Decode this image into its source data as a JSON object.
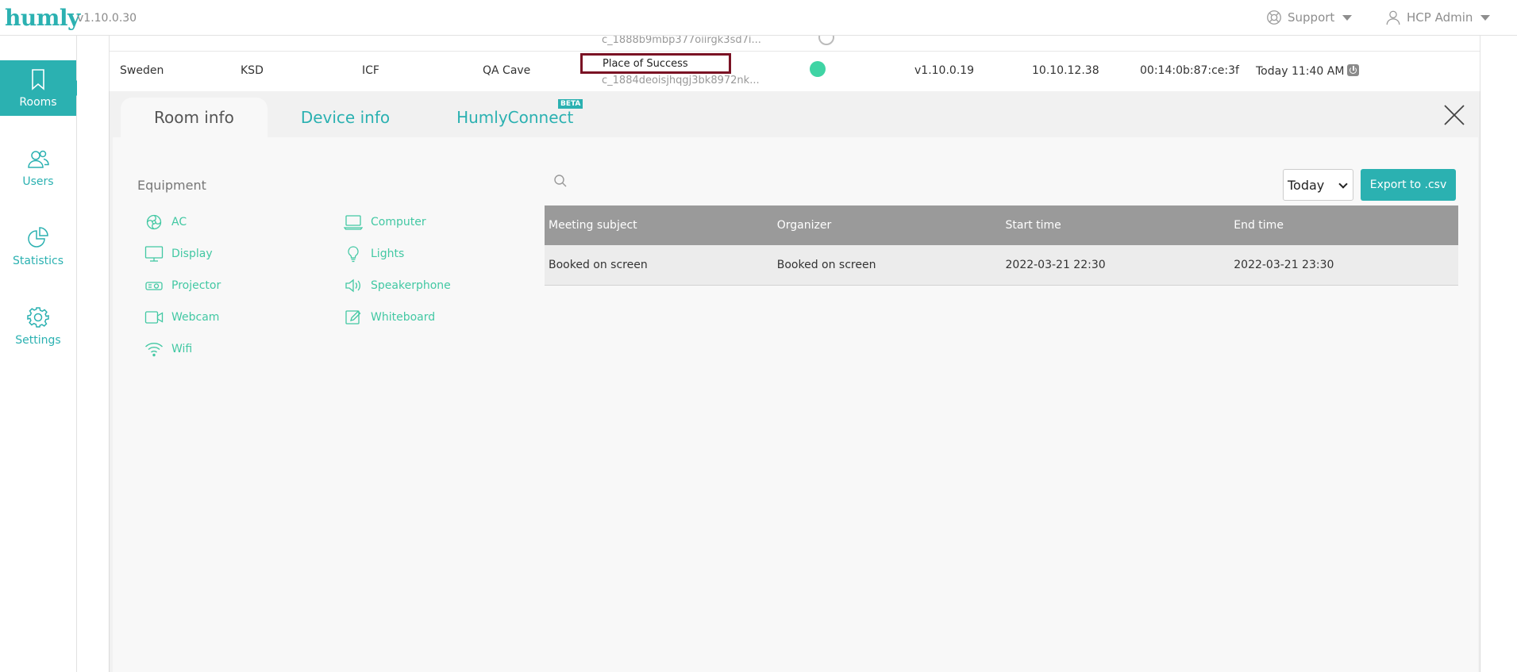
{
  "app": {
    "logo": "humly",
    "version": "v1.10.0.30",
    "support_label": "Support",
    "user_label": "HCP Admin"
  },
  "sidebar": {
    "items": [
      {
        "label": "Rooms",
        "icon": "bookmark-icon",
        "active": true
      },
      {
        "label": "Users",
        "icon": "users-icon",
        "active": false
      },
      {
        "label": "Statistics",
        "icon": "pie-chart-icon",
        "active": false
      },
      {
        "label": "Settings",
        "icon": "gear-icon",
        "active": false
      }
    ]
  },
  "device_table": {
    "partial_row": {
      "room_id": "c_1888b9mbp377oiirgk3sd7i..."
    },
    "row": {
      "country": "Sweden",
      "city": "KSD",
      "building": "ICF",
      "floor": "QA Cave",
      "room_name": "Place of Success",
      "room_id": "c_1884deoisjhqgj3bk8972nk...",
      "version": "v1.10.0.19",
      "ip": "10.10.12.38",
      "mac": "00:14:0b:87:ce:3f",
      "last_seen": "Today 11:40 AM"
    }
  },
  "detail": {
    "tabs": [
      {
        "label": "Room info",
        "active": true
      },
      {
        "label": "Device info",
        "active": false
      },
      {
        "label": "HumlyConnect",
        "active": false,
        "badge": "BETA"
      }
    ],
    "equipment_title": "Equipment",
    "equipment": [
      {
        "label": "AC",
        "icon": "ac-icon"
      },
      {
        "label": "Computer",
        "icon": "computer-icon"
      },
      {
        "label": "Display",
        "icon": "display-icon"
      },
      {
        "label": "Lights",
        "icon": "lightbulb-icon"
      },
      {
        "label": "Projector",
        "icon": "projector-icon"
      },
      {
        "label": "Speakerphone",
        "icon": "speakerphone-icon"
      },
      {
        "label": "Webcam",
        "icon": "webcam-icon"
      },
      {
        "label": "Whiteboard",
        "icon": "whiteboard-icon"
      },
      {
        "label": "Wifi",
        "icon": "wifi-icon"
      }
    ],
    "search_placeholder": "",
    "date_filter": "Today",
    "export_label": "Export to .csv",
    "meetings": {
      "columns": [
        "Meeting subject",
        "Organizer",
        "Start time",
        "End time"
      ],
      "rows": [
        [
          "Booked on screen",
          "Booked on screen",
          "2022-03-21 22:30",
          "2022-03-21 23:30"
        ]
      ]
    }
  },
  "colors": {
    "accent": "#2bb1b1",
    "equipment": "#42c8a3",
    "status_online": "#3fd4a4",
    "highlight_border": "#7a1224"
  }
}
